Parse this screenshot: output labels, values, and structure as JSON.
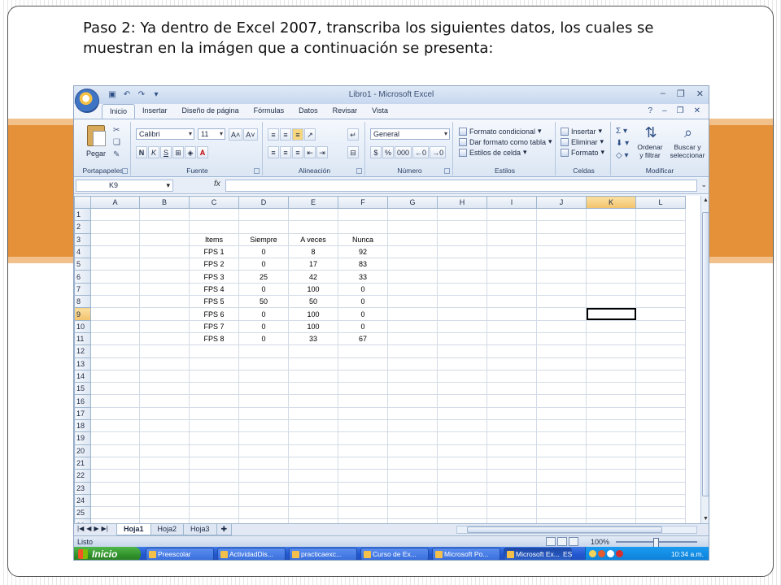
{
  "slide": {
    "title": "Paso 2:  Ya dentro de Excel 2007, transcriba los siguientes datos, los cuales se muestran en la imágen que a continuación se presenta:"
  },
  "excel": {
    "window_title": "Libro1 - Microsoft Excel",
    "tabs": [
      "Inicio",
      "Insertar",
      "Diseño de página",
      "Fórmulas",
      "Datos",
      "Revisar",
      "Vista"
    ],
    "active_tab": "Inicio",
    "ribbon": {
      "clipboard": {
        "label": "Portapapeles",
        "paste": "Pegar"
      },
      "font": {
        "label": "Fuente",
        "font_name": "Calibri",
        "font_size": "11"
      },
      "alignment": {
        "label": "Alineación"
      },
      "number": {
        "label": "Número",
        "format": "General",
        "percent": "%",
        "thousands": "000"
      },
      "styles": {
        "label": "Estilos",
        "conditional": "Formato condicional",
        "as_table": "Dar formato como tabla",
        "cell_styles": "Estilos de celda"
      },
      "cells": {
        "label": "Celdas",
        "insert": "Insertar",
        "delete": "Eliminar",
        "format": "Formato"
      },
      "editing": {
        "label": "Modificar",
        "sort": "Ordenar\ny filtrar",
        "find": "Buscar y\nseleccionar"
      }
    },
    "formula_bar": {
      "name_box": "K9",
      "fx": "fx",
      "value": ""
    },
    "columns": [
      "A",
      "B",
      "C",
      "D",
      "E",
      "F",
      "G",
      "H",
      "I",
      "J",
      "K",
      "L"
    ],
    "selected_column": "K",
    "selected_row": 9,
    "row_count": 26,
    "data_start_row": 3,
    "data_start_col": 2,
    "cells": [
      [
        "Items",
        "Siempre",
        "A veces",
        "Nunca"
      ],
      [
        "FPS 1",
        "0",
        "8",
        "92"
      ],
      [
        "FPS 2",
        "0",
        "17",
        "83"
      ],
      [
        "FPS 3",
        "25",
        "42",
        "33"
      ],
      [
        "FPS 4",
        "0",
        "100",
        "0"
      ],
      [
        "FPS 5",
        "50",
        "50",
        "0"
      ],
      [
        "FPS 6",
        "0",
        "100",
        "0"
      ],
      [
        "FPS 7",
        "0",
        "100",
        "0"
      ],
      [
        "FPS 8",
        "0",
        "33",
        "67"
      ]
    ],
    "sheets": [
      "Hoja1",
      "Hoja2",
      "Hoja3"
    ],
    "active_sheet": "Hoja1",
    "status": "Listo",
    "zoom": "100%"
  },
  "taskbar": {
    "start": "Inicio",
    "items": [
      "Preescolar",
      "ActividadDis...",
      "practicaexc...",
      "Curso de Ex...",
      "Microsoft Po...",
      "Microsoft Ex..."
    ],
    "active_item": 5,
    "language": "ES",
    "clock": "10:34 a.m."
  }
}
